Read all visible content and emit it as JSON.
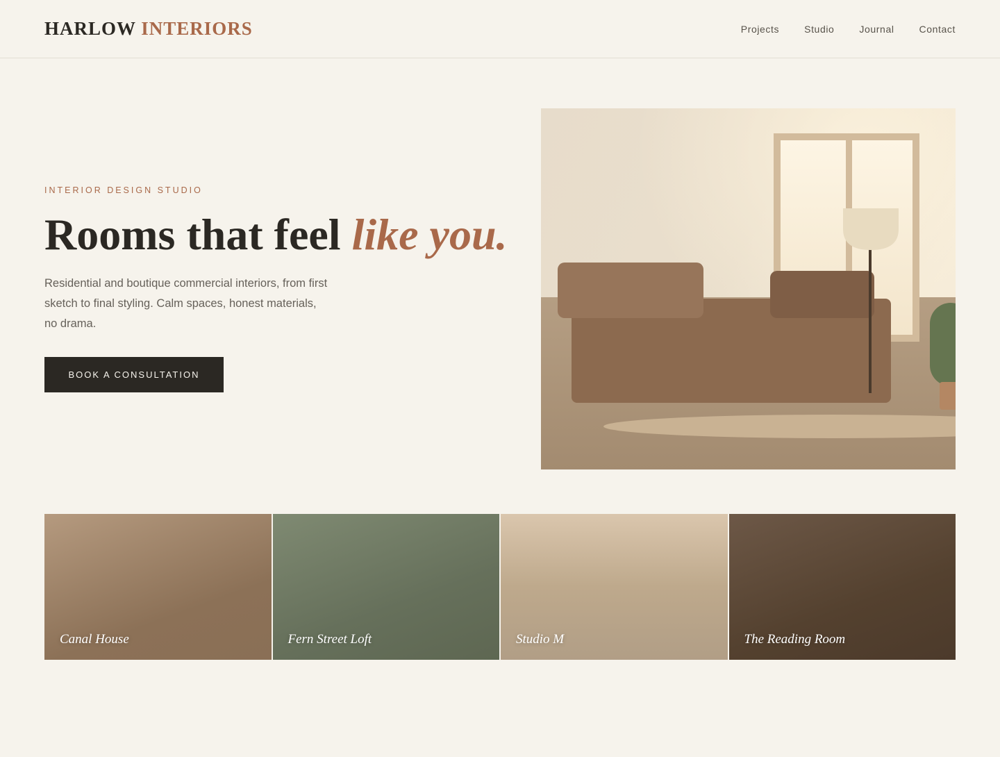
{
  "brand": {
    "name_primary": "HARLOW",
    "name_secondary": "INTERIORS"
  },
  "nav": {
    "items": [
      "Projects",
      "Studio",
      "Journal",
      "Contact"
    ]
  },
  "hero": {
    "eyebrow": "INTERIOR DESIGN STUDIO",
    "headline_plain": "Rooms that feel ",
    "headline_emphasis": "like you.",
    "lede": "Residential and boutique commercial interiors, from first sketch to final styling. Calm spaces, honest materials, no drama.",
    "cta_label": "BOOK A CONSULTATION",
    "image_icon": "living-room-illustration"
  },
  "projects": [
    {
      "title": "Canal House"
    },
    {
      "title": "Fern Street Loft"
    },
    {
      "title": "Studio M"
    },
    {
      "title": "The Reading Room"
    }
  ],
  "colors": {
    "background": "#f6f3ec",
    "text": "#2b2823",
    "accent": "#a9694a",
    "button": "#2b2823"
  }
}
